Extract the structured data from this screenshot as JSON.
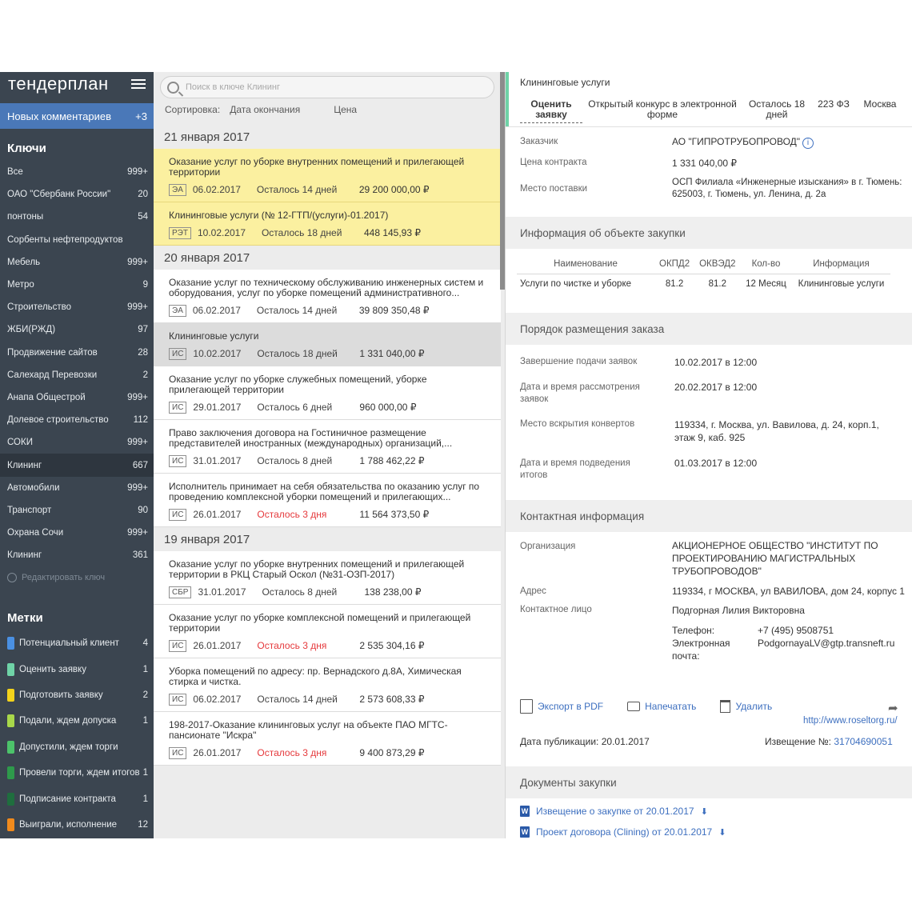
{
  "sidebar": {
    "logo": "тендерплан",
    "comments_label": "Новых комментариев",
    "comments_count": "+3",
    "keys_title": "Ключи",
    "keys": [
      {
        "label": "Все",
        "count": "999+"
      },
      {
        "label": "ОАО \"Сбербанк России\"",
        "count": "20"
      },
      {
        "label": "понтоны",
        "count": "54"
      },
      {
        "label": "Сорбенты нефтепродуктов",
        "count": ""
      },
      {
        "label": "Мебель",
        "count": "999+"
      },
      {
        "label": "Метро",
        "count": "9"
      },
      {
        "label": "Строительство",
        "count": "999+"
      },
      {
        "label": "ЖБИ(РЖД)",
        "count": "97"
      },
      {
        "label": "Продвижение сайтов",
        "count": "28"
      },
      {
        "label": "Салехард Перевозки",
        "count": "2"
      },
      {
        "label": "Анапа Общестрой",
        "count": "999+"
      },
      {
        "label": "Долевое строительство",
        "count": "112"
      },
      {
        "label": "СОКИ",
        "count": "999+"
      },
      {
        "label": "Клининг",
        "count": "667"
      },
      {
        "label": "Автомобили",
        "count": "999+"
      },
      {
        "label": "Транспорт",
        "count": "90"
      },
      {
        "label": "Охрана Сочи",
        "count": "999+"
      },
      {
        "label": "Клининг",
        "count": "361"
      }
    ],
    "active_key_index": 13,
    "edit_key": "Редактировать ключ",
    "labels_title": "Метки",
    "labels": [
      {
        "label": "Потенциальный клиент",
        "count": "4",
        "color": "#4a90e2"
      },
      {
        "label": "Оценить заявку",
        "count": "1",
        "color": "#6fd3a7"
      },
      {
        "label": "Подготовить заявку",
        "count": "2",
        "color": "#f2d21b"
      },
      {
        "label": "Подали, ждем допуска",
        "count": "1",
        "color": "#a8d84a"
      },
      {
        "label": "Допустили, ждем торги",
        "count": "",
        "color": "#4cc36a"
      },
      {
        "label": "Провели торги, ждем итогов",
        "count": "1",
        "color": "#2e9a4b"
      },
      {
        "label": "Подписание контракта",
        "count": "1",
        "color": "#1f6e3e"
      },
      {
        "label": "Выиграли, исполнение",
        "count": "12",
        "color": "#f08a1c"
      }
    ]
  },
  "list": {
    "search_placeholder": "Поиск в ключе Клининг",
    "sort_label": "Сортировка:",
    "sort_date": "Дата окончания",
    "sort_price": "Цена",
    "groups": [
      {
        "date": "21 января 2017",
        "cards": [
          {
            "title": "Оказание услуг по уборке внутренних помещений и прилегающей территории",
            "badge": "ЭА",
            "date": "06.02.2017",
            "left": "Осталось 14 дней",
            "price": "29 200 000,00 ₽",
            "style": "yellow",
            "urgent": false
          },
          {
            "title": "Клининговые услуги (№ 12-ГТП/(услуги)-01.2017)",
            "badge": "РЭТ",
            "date": "10.02.2017",
            "left": "Осталось 18 дней",
            "price": "448 145,93 ₽",
            "style": "yellow",
            "urgent": false
          }
        ]
      },
      {
        "date": "20 января 2017",
        "cards": [
          {
            "title": "Оказание услуг по техническому обслуживанию инженерных систем и оборудования, услуг по уборке помещений административного...",
            "badge": "ЭА",
            "date": "06.02.2017",
            "left": "Осталось 14 дней",
            "price": "39 809 350,48 ₽",
            "style": "white",
            "urgent": false
          },
          {
            "title": "Клининговые услуги",
            "badge": "ИС",
            "date": "10.02.2017",
            "left": "Осталось 18 дней",
            "price": "1 331 040,00 ₽",
            "style": "gray",
            "urgent": false
          },
          {
            "title": "Оказание услуг по уборке служебных помещений, уборке прилегающей территории",
            "badge": "ИС",
            "date": "29.01.2017",
            "left": "Осталось 6 дней",
            "price": "960 000,00 ₽",
            "style": "white",
            "urgent": false
          },
          {
            "title": "Право заключения договора на Гостиничное размещение представителей иностранных (международных) организаций,...",
            "badge": "ИС",
            "date": "31.01.2017",
            "left": "Осталось 8 дней",
            "price": "1 788 462,22 ₽",
            "style": "white",
            "urgent": false
          },
          {
            "title": "Исполнитель принимает на себя обязательства по оказанию услуг по проведению комплексной уборки помещений и прилегающих...",
            "badge": "ИС",
            "date": "26.01.2017",
            "left": "Осталось 3 дня",
            "price": "11 564 373,50 ₽",
            "style": "white",
            "urgent": true
          }
        ]
      },
      {
        "date": "19 января 2017",
        "cards": [
          {
            "title": "Оказание услуг по уборке внутренних помещений и прилегающей территории в РКЦ Старый Оскол (№31-ОЗП-2017)",
            "badge": "СБР",
            "date": "31.01.2017",
            "left": "Осталось 8 дней",
            "price": "138 238,00 ₽",
            "style": "white",
            "urgent": false
          },
          {
            "title": "Оказание услуг по уборке комплексной помещений и прилегающей территории",
            "badge": "ИС",
            "date": "26.01.2017",
            "left": "Осталось 3 дня",
            "price": "2 535 304,16 ₽",
            "style": "white",
            "urgent": true
          },
          {
            "title": "Уборка помещений по адресу: пр. Вернадского д.8А, Химическая стирка и чистка.",
            "badge": "ИС",
            "date": "06.02.2017",
            "left": "Осталось 14 дней",
            "price": "2 573 608,33 ₽",
            "style": "white",
            "urgent": false
          },
          {
            "title": "198-2017-Оказание клининговых услуг на объекте ПАО МГТС-пансионате \"Искра\"",
            "badge": "ИС",
            "date": "26.01.2017",
            "left": "Осталось 3 дня",
            "price": "9 400 873,29 ₽",
            "style": "white",
            "urgent": true
          }
        ]
      }
    ]
  },
  "detail": {
    "title": "Клининговые услуги",
    "tabs": {
      "rate": "Оценить заявку",
      "type": "Открытый конкурс в электронной форме",
      "left": "Осталось 18 дней",
      "law": "223 ФЗ",
      "city": "Москва"
    },
    "customer_label": "Заказчик",
    "customer": "АО \"ГИПРОТРУБОПРОВОД\"",
    "price_label": "Цена контракта",
    "price": "1 331 040,00 ₽",
    "place_label": "Место поставки",
    "place": "ОСП Филиала «Инженерные изыскания» в г. Тюмень: 625003, г. Тюмень, ул. Ленина, д. 2а",
    "object_section": "Информация об объекте закупки",
    "object_table": {
      "headers": [
        "Наименование",
        "ОКПД2",
        "ОКВЭД2",
        "Кол-во",
        "Информация"
      ],
      "row": [
        "Услуги по чистке и уборке",
        "81.2",
        "81.2",
        "12 Месяц",
        "Клининговые услуги"
      ]
    },
    "order_section": "Порядок размещения заказа",
    "order": [
      {
        "label": "Завершение подачи заявок",
        "value": "10.02.2017 в 12:00"
      },
      {
        "label": "Дата и время рассмотрения заявок",
        "value": "20.02.2017 в 12:00"
      },
      {
        "label": "Место вскрытия конвертов",
        "value": "119334, г. Москва, ул. Вавилова, д. 24, корп.1, этаж 9, каб. 925"
      },
      {
        "label": "Дата и время подведения итогов",
        "value": "01.03.2017 в 12:00"
      }
    ],
    "contact_section": "Контактная информация",
    "org_label": "Организация",
    "org": "АКЦИОНЕРНОЕ ОБЩЕСТВО \"ИНСТИТУТ ПО ПРОЕКТИРОВАНИЮ МАГИСТРАЛЬНЫХ ТРУБОПРОВОДОВ\"",
    "address_label": "Адрес",
    "address": "119334, г МОСКВА, ул ВАВИЛОВА, дом 24, корпус 1",
    "person_label": "Контактное лицо",
    "person": "Подгорная Лилия Викторовна",
    "phone_label": "Телефон:",
    "phone": "+7 (495) 9508751",
    "email_label": "Электронная почта:",
    "email": "PodgornayaLV@gtp.transneft.ru",
    "export_pdf": "Экспорт в PDF",
    "print": "Напечатать",
    "delete": "Удалить",
    "site": "http://www.roseltorg.ru/",
    "pub_label": "Дата публикации:",
    "pub_date": "20.01.2017",
    "notice_label": "Извещение №:",
    "notice_no": "31704690051",
    "docs_section": "Документы закупки",
    "docs": [
      "Извещение о закупке от 20.01.2017",
      "Проект договора (Clining) от 20.01.2017"
    ]
  }
}
